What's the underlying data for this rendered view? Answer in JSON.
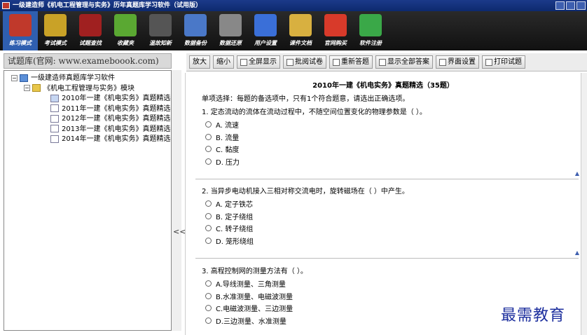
{
  "window": {
    "title": "一级建造师《机电工程管理与实务》历年真题库学习软件（试用版）"
  },
  "toolbar": {
    "items": [
      {
        "label": "练习模式",
        "icon": "books-icon",
        "color": "#c0392b",
        "active": true
      },
      {
        "label": "考试模式",
        "icon": "exam-clock-icon",
        "color": "#c9a227"
      },
      {
        "label": "试题查找",
        "icon": "search-icon",
        "color": "#a02020"
      },
      {
        "label": "收藏夹",
        "icon": "favorites-icon",
        "color": "#5aa832"
      },
      {
        "label": "温故知新",
        "icon": "review-icon",
        "color": "#555555"
      },
      {
        "label": "数据备份",
        "icon": "backup-disk-icon",
        "color": "#4a78c8"
      },
      {
        "label": "数据还原",
        "icon": "restore-icon",
        "color": "#888888"
      },
      {
        "label": "用户设置",
        "icon": "user-settings-icon",
        "color": "#3a6fd8"
      },
      {
        "label": "课件文档",
        "icon": "document-icon",
        "color": "#d8b040"
      },
      {
        "label": "官网购买",
        "icon": "ie-browser-icon",
        "color": "#d83a2a"
      },
      {
        "label": "软件注册",
        "icon": "users-register-icon",
        "color": "#3aa848"
      }
    ]
  },
  "left_panel": {
    "header": "试题库(官网: www.exameboook.com)",
    "tree": {
      "root": "一级建造师真题库学习软件",
      "module": "《机电工程管理与实务》模块",
      "items": [
        "2010年一建《机电实务》真题精选",
        "2011年一建《机电实务》真题精选",
        "2012年一建《机电实务》真题精选",
        "2013年一建《机电实务》真题精选",
        "2014年一建《机电实务》真题精选"
      ]
    }
  },
  "buttons": {
    "zoom_in": "放大",
    "zoom_out": "缩小",
    "fullscreen": "全屏显示",
    "grade": "批阅试卷",
    "redo": "重新答题",
    "show_answers": "显示全部答案",
    "ui_settings": "界面设置",
    "print": "打印试题"
  },
  "paper": {
    "title": "2010年一建《机电实务》真题精选（35题）",
    "instruction": "单项选择：每题的备选项中，只有1个符合题意，请选出正确选项。",
    "questions": [
      {
        "text": "1. 定态流动的流体在流动过程中，不随空间位置变化的物理参数是（    ）。",
        "options": [
          "A. 流速",
          "B. 流量",
          "C. 黏度",
          "D. 压力"
        ]
      },
      {
        "text": "2. 当异步电动机接入三相对称交流电时，旋转磁场在（    ）中产生。",
        "options": [
          "A. 定子铁芯",
          "B. 定子绕组",
          "C. 转子绕组",
          "D. 笼形绕组"
        ]
      },
      {
        "text": "3. 高程控制网的测量方法有（  ）。",
        "options": [
          "A.导线测量、三角测量",
          "B.水准测量、电磁波测量",
          "C.电磁波测量、三边测量",
          "D.三边测量、水准测量"
        ]
      }
    ]
  },
  "watermark": "最需教育"
}
